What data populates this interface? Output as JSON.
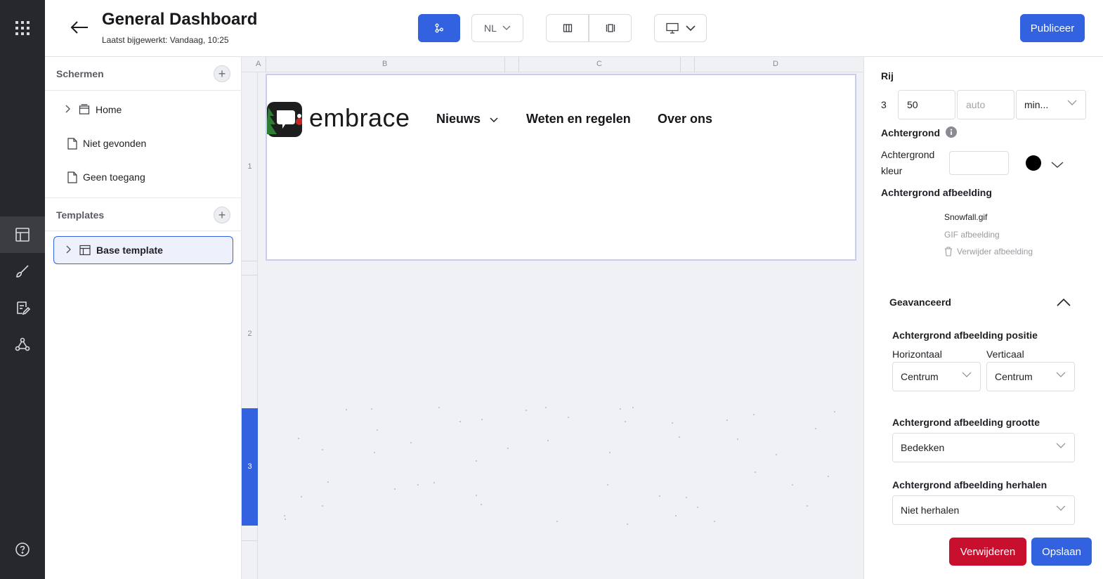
{
  "rail": {
    "items": [
      "apps-grid-icon",
      "layout-icon",
      "brush-icon",
      "edit-list-icon",
      "integrations-icon",
      "help-icon"
    ]
  },
  "header": {
    "title": "General Dashboard",
    "subtitle": "Laatst bijgewerkt: Vandaag, 10:25",
    "language": "NL",
    "publish_label": "Publiceer"
  },
  "screens": {
    "section_title": "Schermen",
    "items": [
      {
        "label": "Home",
        "icon": "screen-icon",
        "expandable": true
      },
      {
        "label": "Niet gevonden",
        "icon": "page-icon",
        "expandable": false
      },
      {
        "label": "Geen toegang",
        "icon": "page-icon",
        "expandable": false
      }
    ]
  },
  "templates": {
    "section_title": "Templates",
    "items": [
      {
        "label": "Base template",
        "icon": "template-icon",
        "selected": true
      }
    ]
  },
  "canvas": {
    "columns": [
      "A",
      "B",
      "C",
      "D"
    ],
    "rows": [
      "1",
      "2",
      "3"
    ],
    "active_row": "3",
    "site": {
      "logo_text": "embrace",
      "nav": [
        "Nieuws",
        "Weten en regelen",
        "Over ons"
      ]
    }
  },
  "properties": {
    "row_heading": "Rij",
    "row_number": "3",
    "height_value": "50",
    "auto_placeholder": "auto",
    "min_select": "min...",
    "background_heading": "Achtergrond",
    "background_color_label": "Achtergrond kleur",
    "background_color_value": "#000000",
    "background_image_label": "Achtergrond afbeelding",
    "image_name": "Snowfall.gif",
    "image_type": "GIF afbeelding",
    "remove_image": "Verwijder afbeelding",
    "advanced_heading": "Geavanceerd",
    "position_label": "Achtergrond afbeelding positie",
    "horizontal_label": "Horizontaal",
    "vertical_label": "Verticaal",
    "horizontal_value": "Centrum",
    "vertical_value": "Centrum",
    "size_label": "Achtergrond afbeelding grootte",
    "size_value": "Bedekken",
    "repeat_label": "Achtergrond afbeelding herhalen",
    "repeat_value": "Niet herhalen",
    "delete_label": "Verwijderen",
    "save_label": "Opslaan"
  },
  "colors": {
    "accent": "#3262e0",
    "danger": "#c8102e",
    "rail": "#26282d"
  }
}
